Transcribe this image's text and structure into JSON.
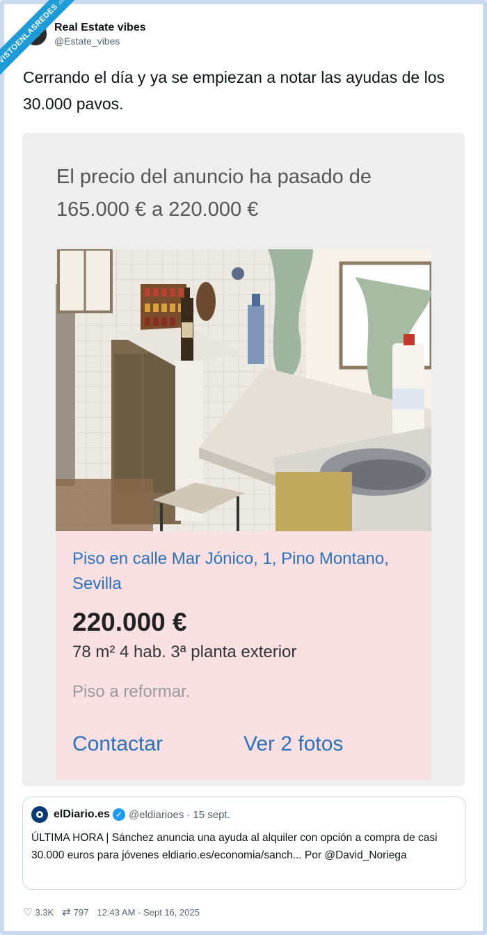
{
  "watermark": {
    "text": "VISTOENLASREDES",
    "suffix": ".com"
  },
  "author": {
    "display_name": "Real Estate vibes",
    "handle": "@Estate_vibes"
  },
  "tweet": {
    "text": "Cerrando el día y ya se empiezan a notar las ayudas de los 30.000 pavos."
  },
  "image": {
    "price_change_text": "El precio del anuncio ha pasado de 165.000 € a 220.000 €",
    "listing": {
      "title": "Piso en calle Mar Jónico, 1, Pino Montano, Sevilla",
      "price": "220.000 €",
      "details": "78 m² 4 hab. 3ª planta exterior",
      "note": "Piso a reformar.",
      "contact_label": "Contactar",
      "photos_label": "Ver 2 fotos"
    }
  },
  "quoted_tweet": {
    "name": "elDiario.es",
    "handle": "@eldiarioes",
    "separator": "·",
    "date": "15 sept.",
    "text": "ÚLTIMA HORA | Sánchez anuncia una ayuda al alquiler con opción a compra de casi 30.000 euros para jóvenes eldiario.es/economia/sanch... Por @David_Noriega"
  },
  "footer": {
    "likes": "3.3K",
    "retweets": "797",
    "timestamp": "12:43 AM - Sept 16, 2025"
  },
  "colors": {
    "link_blue": "#2d72b8",
    "listing_bg": "#f9e0e3",
    "verified": "#1d9bf0",
    "ribbon": "#1f9bd7"
  },
  "icons": [
    "heart-icon",
    "retweet-icon",
    "verified-badge-icon",
    "eldiario-logo-icon"
  ]
}
